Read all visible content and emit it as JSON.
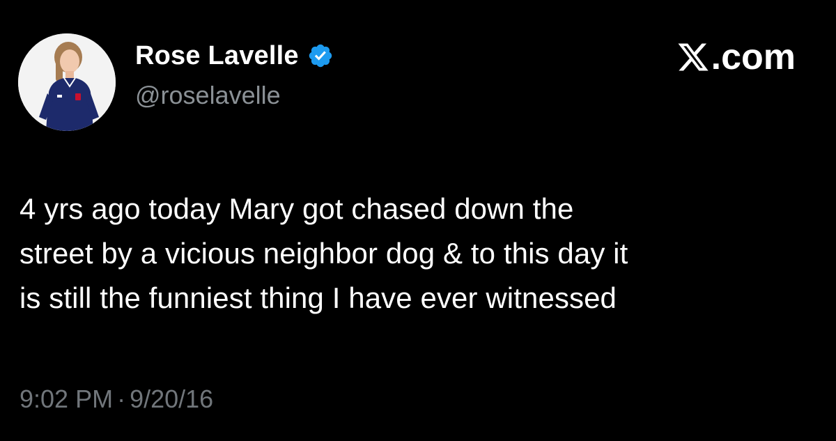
{
  "author": {
    "display_name": "Rose Lavelle",
    "handle": "@roselavelle",
    "verified": true,
    "avatar_icon": "profile-photo"
  },
  "brand": {
    "label": ".com",
    "icon": "x-logo-icon"
  },
  "tweet": {
    "lines": [
      "4 yrs ago today Mary got chased down the",
      "street by a vicious neighbor dog & to this day it",
      "is still the funniest thing I have ever witnessed"
    ],
    "time": "9:02 PM",
    "separator": "·",
    "date": "9/20/16"
  },
  "colors": {
    "background": "#000000",
    "text": "#ffffff",
    "secondary_text": "#71767b",
    "verified_blue": "#1d9bf0"
  }
}
